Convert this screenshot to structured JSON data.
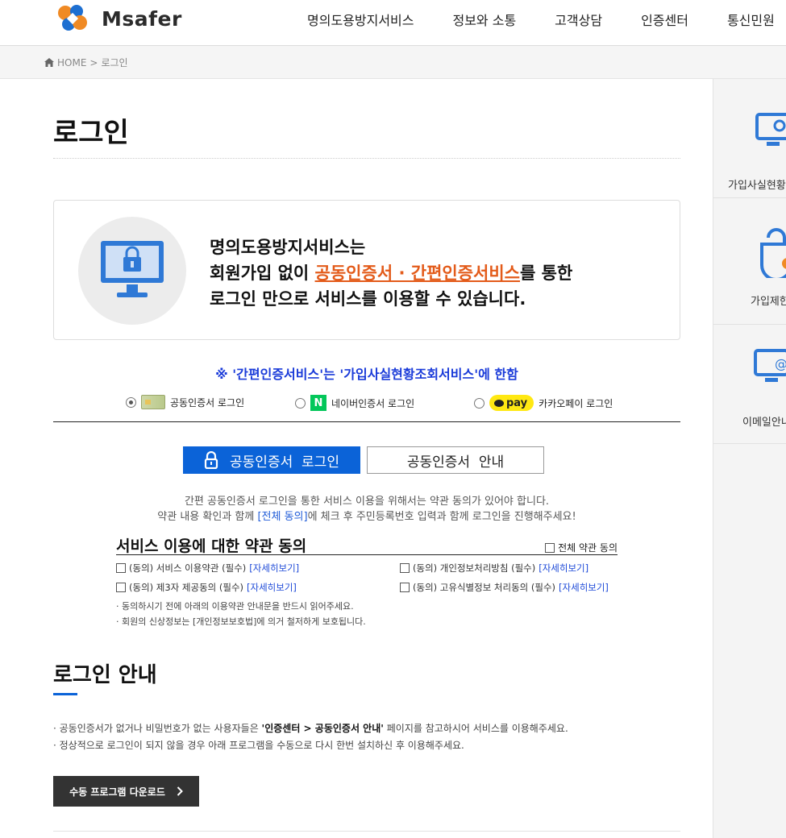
{
  "brand": {
    "name": "Msafer"
  },
  "nav": [
    "명의도용방지서비스",
    "정보와 소통",
    "고객상담",
    "인증센터",
    "통신민원"
  ],
  "breadcrumb": {
    "home": "HOME",
    "separator": ">",
    "current": "로그인"
  },
  "page": {
    "title": "로그인"
  },
  "intro": {
    "line1": "명의도용방지서비스는",
    "line2_before": "회원가입 없이 ",
    "line2_highlight": "공동인증서 · 간편인증서비스",
    "line2_after": "를 통한",
    "line3": "로그인 만으로 서비스를 이용할 수 있습니다."
  },
  "notice": "※ '간편인증서비스'는 '가입사실현황조회서비스'에 한함",
  "methods": [
    {
      "label": "공동인증서 로그인",
      "selected": true,
      "icon": "certificate-card-icon"
    },
    {
      "label": "네이버인증서 로그인",
      "selected": false,
      "icon": "naver-icon",
      "icon_text": "N"
    },
    {
      "label": "카카오페이 로그인",
      "selected": false,
      "icon": "kakaopay-icon",
      "icon_text": "pay"
    }
  ],
  "buttons": {
    "login": "공동인증서  로그인",
    "guide": "공동인증서  안내"
  },
  "desc": {
    "line1": "간편 공동인증서 로그인을 통한 서비스 이용을 위해서는 약관 동의가 있어야 합니다.",
    "line2_before": "약관 내용 확인과 함께 ",
    "line2_link": "[전체 동의]",
    "line2_after": "에 체크 후 주민등록번호 입력과 함께 로그인을 진행해주세요!"
  },
  "terms": {
    "title": "서비스 이용에 대한 약관 동의",
    "all_agree": "전체 약관 동의",
    "items": [
      {
        "label": "(동의) 서비스 이용약관 (필수)",
        "link": "[자세히보기]"
      },
      {
        "label": "(동의) 개인정보처리방침 (필수)",
        "link": "[자세히보기]"
      },
      {
        "label": "(동의) 제3자 제공동의 (필수)",
        "link": "[자세히보기]"
      },
      {
        "label": "(동의) 고유식별정보 처리동의 (필수)",
        "link": "[자세히보기]"
      }
    ],
    "notes": [
      "· 동의하시기 전에 아래의 이용약관 안내문을 반드시 읽어주세요.",
      "· 회원의 신상정보는 [개인정보보호법]에 의거 철저하게 보호됩니다."
    ]
  },
  "guide": {
    "title": "로그인 안내",
    "line1_before": "· 공동인증서가 없거나 비밀번호가 없는 사용자들은 ",
    "line1_bold": "'인증센터 > 공동인증서 안내'",
    "line1_after": " 페이지를 참고하시어 서비스를 이용해주세요.",
    "line2": "· 정상적으로 로그인이 되지 않을 경우 아래 프로그램을 수동으로 다시 한번 설치하신 후 이용해주세요.",
    "download": "수동 프로그램 다운로드"
  },
  "sidebar": [
    {
      "label": "가입사실현황",
      "icon": "monitor-search-icon"
    },
    {
      "label": "가입제한",
      "icon": "lock-shield-icon"
    },
    {
      "label": "이메일안내",
      "icon": "monitor-email-icon"
    }
  ],
  "colors": {
    "accent": "#0b63d8",
    "highlight": "#e35b1a",
    "notice": "#1a3bd9"
  }
}
